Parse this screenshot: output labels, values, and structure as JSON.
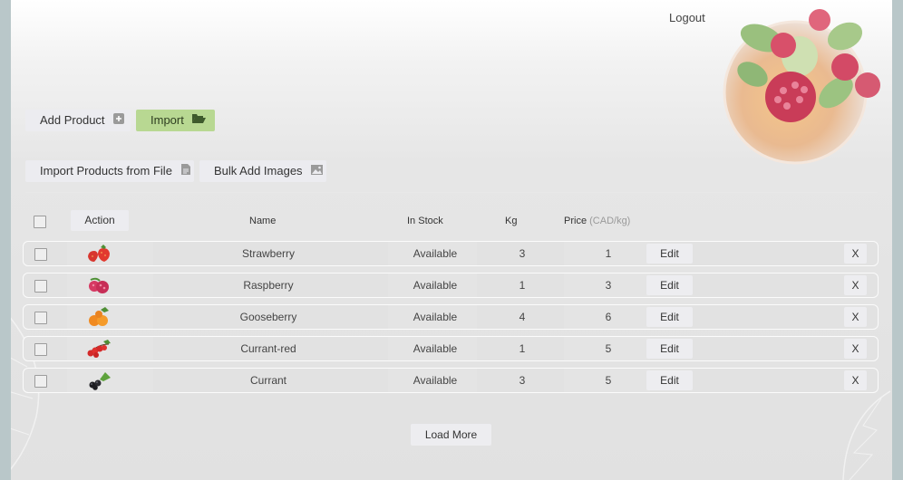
{
  "header": {
    "logout_label": "Logout"
  },
  "toolbar": {
    "add_product_label": "Add Product",
    "import_label": "Import",
    "import_file_label": "Import Products from File",
    "bulk_images_label": "Bulk Add Images"
  },
  "table": {
    "headers": {
      "action": "Action",
      "name": "Name",
      "in_stock": "In Stock",
      "kg": "Kg",
      "price": "Price",
      "price_unit": "(CAD/kg)"
    },
    "edit_label": "Edit",
    "delete_label": "X",
    "rows": [
      {
        "name": "Strawberry",
        "stock": "Available",
        "kg": "3",
        "price": "1",
        "icon": "strawberry-icon"
      },
      {
        "name": "Raspberry",
        "stock": "Available",
        "kg": "1",
        "price": "3",
        "icon": "raspberry-icon"
      },
      {
        "name": "Gooseberry",
        "stock": "Available",
        "kg": "4",
        "price": "6",
        "icon": "gooseberry-icon"
      },
      {
        "name": "Currant-red",
        "stock": "Available",
        "kg": "1",
        "price": "5",
        "icon": "red-currant-icon"
      },
      {
        "name": "Currant",
        "stock": "Available",
        "kg": "3",
        "price": "5",
        "icon": "black-currant-icon"
      }
    ]
  },
  "footer": {
    "load_more_label": "Load More"
  },
  "colors": {
    "accent_green": "#b8d892",
    "button_bg": "#ececf0",
    "page_bg": "#e1e1e1",
    "frame_bg": "#b9c7c9"
  }
}
